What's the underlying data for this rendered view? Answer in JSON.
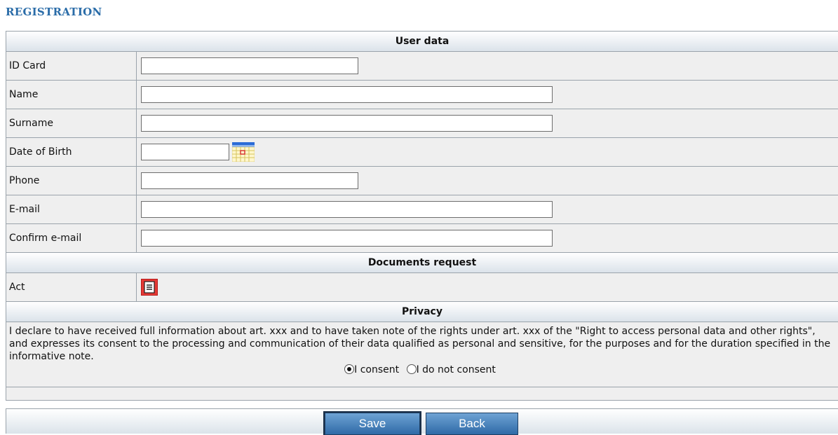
{
  "page": {
    "title": "REGISTRATION"
  },
  "sections": {
    "user_data": "User data",
    "documents": "Documents request",
    "privacy": "Privacy"
  },
  "fields": {
    "id_card": {
      "label": "ID Card",
      "value": ""
    },
    "name": {
      "label": "Name",
      "value": ""
    },
    "surname": {
      "label": "Surname",
      "value": ""
    },
    "dob": {
      "label": "Date of Birth",
      "value": "",
      "icon": "calendar-icon"
    },
    "phone": {
      "label": "Phone",
      "value": ""
    },
    "email": {
      "label": "E-mail",
      "value": ""
    },
    "confirm_email": {
      "label": "Confirm e-mail",
      "value": ""
    }
  },
  "documents": {
    "act": {
      "label": "Act",
      "icon": "document-list-icon",
      "icon_color": "#e53935"
    }
  },
  "privacy": {
    "text": "I declare to have received full information about art. xxx and to have taken note of the rights under art. xxx of the \"Right to access personal data and other rights\", and expresses its consent to the processing and communication of their data qualified as personal and sensitive, for the purposes and for the duration specified in the informative note.",
    "consent_label": "I consent",
    "no_consent_label": "I do not consent",
    "selected": "consent"
  },
  "buttons": {
    "save": "Save",
    "back": "Back"
  },
  "colors": {
    "title": "#2a6ca8",
    "button": "#3b78b5",
    "header_gradient_end": "#dbe3ea",
    "row_background": "#efefef"
  }
}
